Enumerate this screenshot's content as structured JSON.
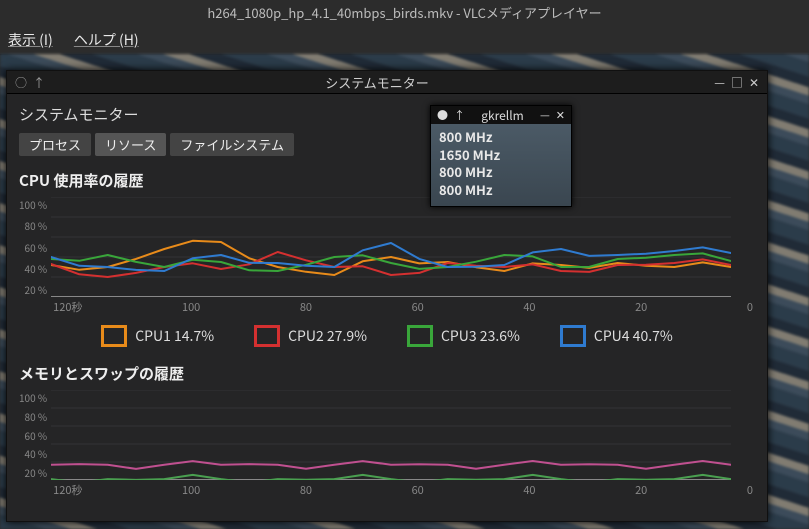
{
  "vlc": {
    "title": "h264_1080p_hp_4.1_40mbps_birds.mkv - VLCメディアプレイヤー",
    "menu": {
      "view": "表示 (I)",
      "help": "ヘルプ (H)"
    }
  },
  "sysmon": {
    "window_title": "システムモニター",
    "app_title": "システムモニター",
    "tabs": {
      "processes": "プロセス",
      "resources": "リソース",
      "filesystems": "ファイルシステム"
    },
    "cpu_section_title": "CPU 使用率の履歴",
    "mem_section_title": "メモリとスワップの履歴",
    "y_ticks": [
      "100 %",
      "80 %",
      "60 %",
      "40 %",
      "20 %"
    ],
    "mem_y_ticks": [
      "100 %",
      "80 %",
      "60 %",
      "40 %",
      "20 %"
    ],
    "x_ticks": [
      "120秒",
      "100",
      "80",
      "60",
      "40",
      "20",
      "0"
    ],
    "legend": {
      "cpu1": "CPU1 14.7%",
      "cpu2": "CPU2 27.9%",
      "cpu3": "CPU3 23.6%",
      "cpu4": "CPU4 40.7%"
    },
    "colors": {
      "cpu1": "#e88b1a",
      "cpu2": "#d43030",
      "cpu3": "#39a63a",
      "cpu4": "#2f7bd0",
      "mem": "#c05090",
      "swap": "#4aa050"
    }
  },
  "gkrellm": {
    "title": "gkrellm",
    "lines": [
      "800 MHz",
      "1650 MHz",
      "800 MHz",
      "800 MHz"
    ]
  },
  "chart_data": {
    "type": "line",
    "title": "CPU 使用率の履歴",
    "xlabel": "秒",
    "ylabel": "%",
    "ylim": [
      0,
      100
    ],
    "x_seconds_ago": [
      120,
      110,
      100,
      90,
      80,
      70,
      60,
      50,
      40,
      30,
      20,
      10,
      0
    ],
    "series": [
      {
        "name": "CPU1",
        "color": "#e88b1a",
        "values": [
          32,
          30,
          48,
          55,
          30,
          22,
          40,
          35,
          26,
          32,
          34,
          30,
          30
        ]
      },
      {
        "name": "CPU2",
        "color": "#d43030",
        "values": [
          33,
          20,
          30,
          28,
          45,
          30,
          22,
          34,
          30,
          26,
          32,
          34,
          32
        ]
      },
      {
        "name": "CPU3",
        "color": "#39a63a",
        "values": [
          38,
          42,
          30,
          35,
          26,
          40,
          34,
          30,
          42,
          30,
          38,
          42,
          36
        ]
      },
      {
        "name": "CPU4",
        "color": "#2f7bd0",
        "values": [
          40,
          30,
          26,
          42,
          34,
          30,
          54,
          30,
          32,
          48,
          42,
          46,
          44
        ]
      }
    ],
    "mem_chart": {
      "type": "line",
      "ylim": [
        0,
        100
      ],
      "series": [
        {
          "name": "メモリ",
          "color": "#c05090",
          "values": [
            17,
            17,
            17,
            17,
            17,
            17,
            17,
            17,
            17,
            17,
            17,
            17,
            17
          ]
        },
        {
          "name": "スワップ",
          "color": "#4aa050",
          "values": [
            1,
            1,
            1,
            1,
            1,
            1,
            1,
            1,
            1,
            1,
            1,
            1,
            1
          ]
        }
      ]
    }
  }
}
